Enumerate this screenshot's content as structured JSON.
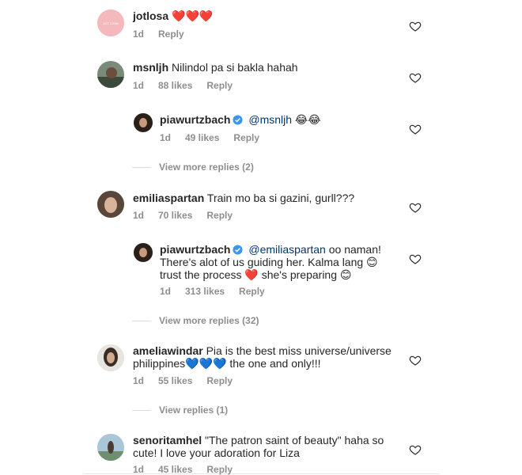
{
  "comments": [
    {
      "username": "jotlosa",
      "text": "❤️❤️❤️",
      "time": "1d",
      "likes": "",
      "reply": "Reply",
      "avatar_text": "JOT LOSA"
    },
    {
      "username": "msnljh",
      "text": "Nilindol pa si bakla hahah",
      "time": "1d",
      "likes": "88 likes",
      "reply": "Reply",
      "replies": [
        {
          "username": "piawurtzbach",
          "mention": "@msnljh",
          "text": "😂😂",
          "time": "1d",
          "likes": "49 likes",
          "reply": "Reply"
        }
      ],
      "view_more": "View more replies (2)"
    },
    {
      "username": "emiliaspartan",
      "text": "Train mo ba si gazini, gurll???",
      "time": "1d",
      "likes": "70 likes",
      "reply": "Reply",
      "replies": [
        {
          "username": "piawurtzbach",
          "mention": "@emiliaspartan",
          "text_line1": "oo naman!",
          "text_line2": "There's alot of us guiding her. Kalma lang 😊",
          "text_line3a": "trust the process",
          "text_line3b": "she's preparing 😊",
          "time": "1d",
          "likes": "313 likes",
          "reply": "Reply"
        }
      ],
      "view_more": "View more replies (32)"
    },
    {
      "username": "ameliawindar",
      "text_line1": "Pia is the best miss universe/universe",
      "text_line2a": "philippines",
      "text_line2b": "the one and only!!!",
      "time": "1d",
      "likes": "55 likes",
      "reply": "Reply",
      "view_more": "View replies (1)"
    },
    {
      "username": "senoritamhel",
      "text_line1": "\"The patron saint of beauty\" haha so",
      "text_line2": "cute! I love your adoration for Liza",
      "time": "1d",
      "likes": "45 likes",
      "reply": "Reply"
    }
  ],
  "colors": {
    "text": "#262626",
    "meta": "#8e8e8e",
    "mention": "#003569",
    "verified": "#3897f0"
  }
}
